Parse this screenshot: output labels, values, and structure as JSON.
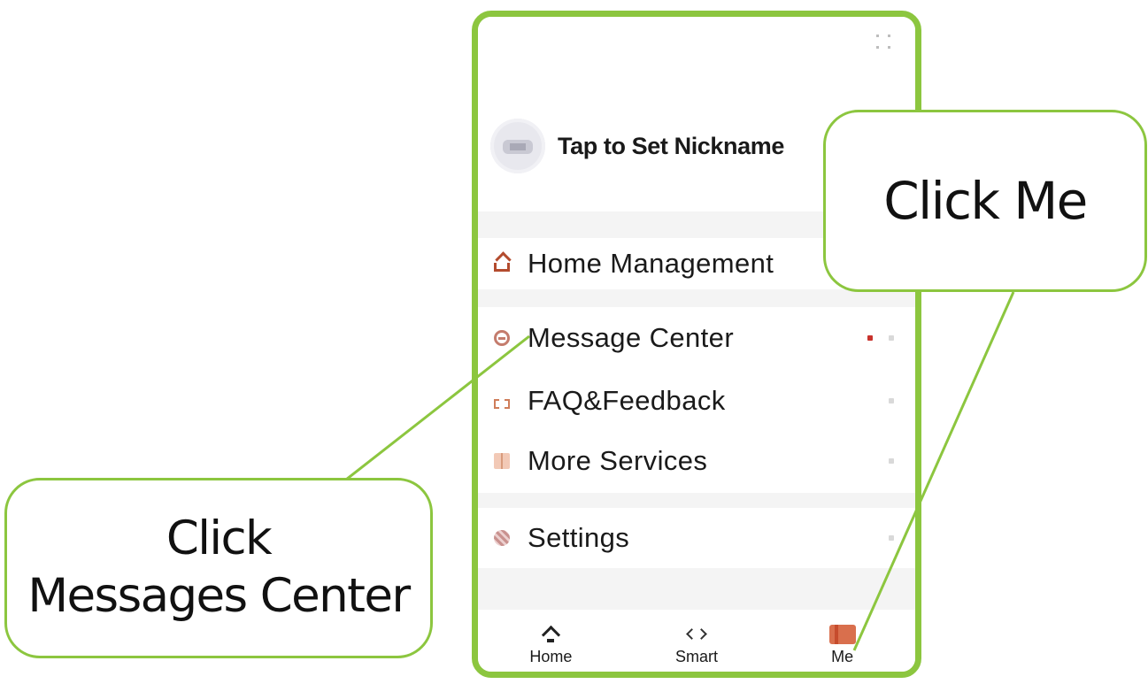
{
  "phone": {
    "frame_color": "#8cc63f",
    "profile": {
      "nickname_prompt": "Tap to Set Nickname"
    },
    "menu": {
      "home_management": "Home Management",
      "message_center": "Message Center",
      "faq_feedback": "FAQ&Feedback",
      "more_services": "More Services",
      "settings": "Settings"
    },
    "bottom_nav": {
      "tabs": [
        {
          "label": "Home",
          "icon": "home-icon"
        },
        {
          "label": "Smart",
          "icon": "smart-icon"
        },
        {
          "label": "Me",
          "icon": "me-icon",
          "active": true
        }
      ]
    }
  },
  "callouts": {
    "click_me": "Click Me",
    "click_messages_line1": "Click",
    "click_messages_line2": "Messages Center",
    "border_color": "#8cc63f"
  }
}
